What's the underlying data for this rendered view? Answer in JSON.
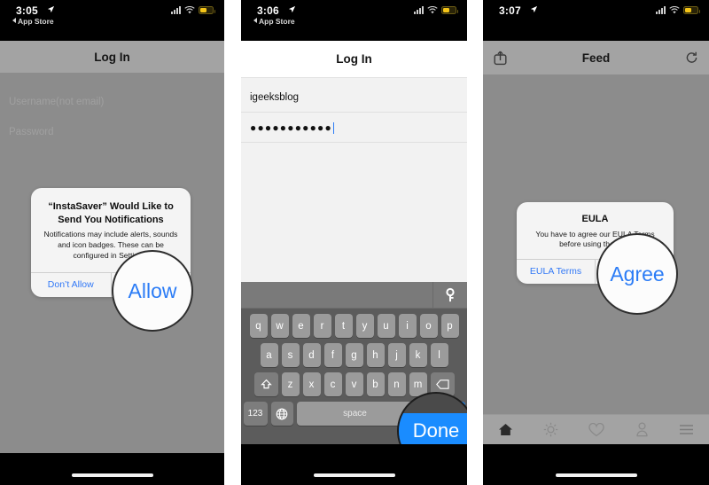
{
  "panels": [
    {
      "name": "notifications-permission",
      "statusbar": {
        "time": "3:05",
        "back_label": "App Store",
        "location_icon": "location-arrow-icon",
        "signal_icon": "cellular-bars-icon",
        "wifi_icon": "wifi-icon",
        "battery_icon": "battery-low-power-icon"
      },
      "navbar": {
        "title": "Log In"
      },
      "form": {
        "username_placeholder": "Username(not email)",
        "password_placeholder": "Password"
      },
      "alert": {
        "title": "“InstaSaver” Would Like to Send You Notifications",
        "message": "Notifications may include alerts, sounds and icon badges. These can be configured in Settings.",
        "deny_label": "Don’t Allow",
        "allow_label": "Allow"
      },
      "loupe": {
        "label": "Allow"
      }
    },
    {
      "name": "login-credentials",
      "statusbar": {
        "time": "3:06",
        "back_label": "App Store",
        "location_icon": "location-arrow-icon",
        "signal_icon": "cellular-bars-icon",
        "wifi_icon": "wifi-icon",
        "battery_icon": "battery-low-power-icon"
      },
      "navbar": {
        "title": "Log In"
      },
      "form": {
        "username_value": "igeeksblog",
        "password_value": "●●●●●●●●●●●"
      },
      "keyboard": {
        "accessory_icon": "key-password-icon",
        "row1": [
          "q",
          "w",
          "e",
          "r",
          "t",
          "y",
          "u",
          "i",
          "o",
          "p"
        ],
        "row2": [
          "a",
          "s",
          "d",
          "f",
          "g",
          "h",
          "j",
          "k",
          "l"
        ],
        "row3": [
          "z",
          "x",
          "c",
          "v",
          "b",
          "n",
          "m"
        ],
        "shift_icon": "shift-arrow-icon",
        "backspace_icon": "backspace-icon",
        "numbers_label": "123",
        "globe_icon": "globe-icon",
        "space_label": "space",
        "return_label": "Done"
      },
      "loupe": {
        "label": "Done"
      }
    },
    {
      "name": "feed-eula",
      "statusbar": {
        "time": "3:07",
        "location_icon": "location-arrow-icon",
        "signal_icon": "cellular-bars-icon",
        "wifi_icon": "wifi-icon",
        "battery_icon": "battery-low-power-icon"
      },
      "navbar": {
        "title": "Feed",
        "left_icon": "share-icon",
        "right_icon": "refresh-icon"
      },
      "alert": {
        "title": "EULA",
        "message": "You have to agree our EULA Terms before using the app.",
        "terms_label": "EULA Terms",
        "agree_label": "Agree"
      },
      "loupe": {
        "label": "Agree"
      },
      "tabbar": [
        {
          "icon": "home-icon",
          "active": true
        },
        {
          "icon": "brightness-sun-icon",
          "active": false
        },
        {
          "icon": "heart-icon",
          "active": false
        },
        {
          "icon": "person-icon",
          "active": false
        },
        {
          "icon": "menu-hamburger-icon",
          "active": false
        }
      ]
    }
  ],
  "colors": {
    "ios_blue": "#3178f6",
    "loupe_blue": "#2b7cf6",
    "keyboard_bg": "#5c5c5c",
    "dim_overlay": "#8c8c8c",
    "battery_yellow": "#f5c518"
  }
}
